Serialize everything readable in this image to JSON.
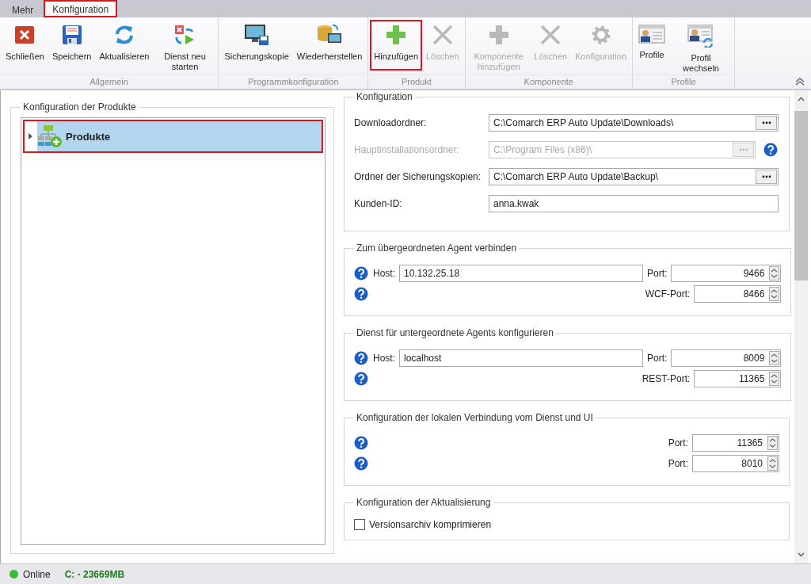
{
  "tabs": [
    {
      "label": "Mehr",
      "selected": false,
      "highlighted": false
    },
    {
      "label": "Konfiguration",
      "selected": true,
      "highlighted": true
    }
  ],
  "ribbon": {
    "groups": [
      {
        "label": "Allgemein",
        "buttons": [
          {
            "label": "Schließen",
            "disabled": false,
            "highlighted": false
          },
          {
            "label": "Speichern",
            "disabled": false,
            "highlighted": false
          },
          {
            "label": "Aktualisieren",
            "disabled": false,
            "highlighted": false
          },
          {
            "label": "Dienst neu starten",
            "disabled": false,
            "highlighted": false
          }
        ]
      },
      {
        "label": "Programmkonfiguration",
        "buttons": [
          {
            "label": "Sicherungskopie",
            "disabled": false,
            "highlighted": false
          },
          {
            "label": "Wiederherstellen",
            "disabled": false,
            "highlighted": false
          }
        ]
      },
      {
        "label": "Produkt",
        "buttons": [
          {
            "label": "Hinzufügen",
            "disabled": false,
            "highlighted": true
          },
          {
            "label": "Löschen",
            "disabled": true,
            "highlighted": false
          }
        ]
      },
      {
        "label": "Komponente",
        "buttons": [
          {
            "label": "Komponente hinzufügen",
            "disabled": true,
            "highlighted": false
          },
          {
            "label": "Löschen",
            "disabled": true,
            "highlighted": false
          },
          {
            "label": "Konfiguration",
            "disabled": true,
            "highlighted": false
          }
        ]
      },
      {
        "label": "Profile",
        "buttons": [
          {
            "label": "Profile",
            "disabled": false,
            "highlighted": false
          },
          {
            "label": "Profil wechseln",
            "disabled": false,
            "highlighted": false
          }
        ]
      }
    ]
  },
  "products": {
    "title": "Konfiguration der Produkte",
    "tree": [
      {
        "label": "Produkte",
        "expanded": false,
        "selected": true,
        "highlighted": true
      }
    ]
  },
  "sections": [
    {
      "kind": "paths",
      "title": "Konfiguration",
      "rows": [
        {
          "label": "Downloadordner:",
          "value": "C:\\Comarch ERP Auto Update\\Downloads\\",
          "disabled": false,
          "browse": true,
          "help": false
        },
        {
          "label": "Hauptinstallationsordner:",
          "value": "C:\\Program Files (x86)\\",
          "disabled": true,
          "browse": true,
          "help": true
        },
        {
          "label": "Ordner der Sicherungskopien:",
          "value": "C:\\Comarch ERP Auto Update\\Backup\\",
          "disabled": false,
          "browse": true,
          "help": false
        },
        {
          "label": "Kunden-ID:",
          "value": "anna.kwak",
          "disabled": false,
          "browse": false,
          "help": false
        }
      ]
    },
    {
      "kind": "endpoints",
      "title": "Zum übergeordneten Agent verbinden",
      "rows": [
        {
          "host": {
            "label": "Host:",
            "value": "10.132.25.18"
          },
          "port": {
            "label": "Port:",
            "value": "9466"
          }
        },
        {
          "port": {
            "label": "WCF-Port:",
            "value": "8466"
          }
        }
      ]
    },
    {
      "kind": "endpoints",
      "title": "Dienst für untergeordnete Agents konfigurieren",
      "rows": [
        {
          "host": {
            "label": "Host:",
            "value": "localhost"
          },
          "port": {
            "label": "Port:",
            "value": "8009"
          }
        },
        {
          "port": {
            "label": "REST-Port:",
            "value": "11365"
          }
        }
      ]
    },
    {
      "kind": "endpoints",
      "title": "Konfiguration der lokalen Verbindung vom Dienst und UI",
      "rows": [
        {
          "port": {
            "label": "Port:",
            "value": "11365"
          }
        },
        {
          "port": {
            "label": "Port:",
            "value": "8010"
          }
        }
      ]
    },
    {
      "kind": "options",
      "title": "Konfiguration der Aktualisierung",
      "rows": [
        {
          "label": "Versionsarchiv komprimieren",
          "checked": false
        }
      ]
    }
  ],
  "status_bar": {
    "online": true,
    "state": "Online",
    "disk": "C: - 23669MB"
  }
}
